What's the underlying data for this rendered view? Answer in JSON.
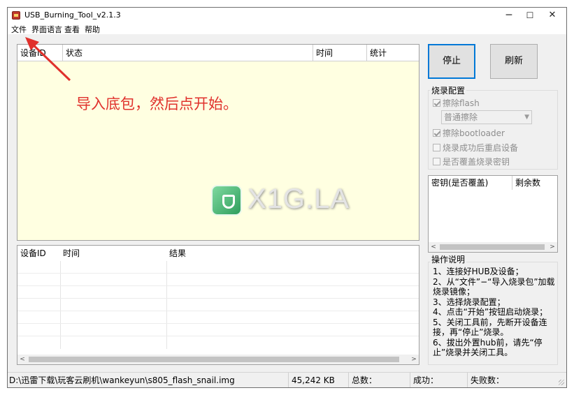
{
  "window": {
    "title": "USB_Burning_Tool_v2.1.3",
    "min": "─",
    "max": "☐",
    "close": "✕"
  },
  "menu": [
    "文件",
    "界面语言",
    "查看",
    "帮助"
  ],
  "device_table": {
    "columns": [
      "设备ID",
      "状态",
      "时间",
      "统计"
    ]
  },
  "hint": "导入底包，然后点开始。",
  "watermark": "X1G.LA",
  "result_table": {
    "columns": [
      "设备ID",
      "时间",
      "结果"
    ]
  },
  "buttons": {
    "stop": "停止",
    "refresh": "刷新"
  },
  "burn_config": {
    "title": "烧录配置",
    "erase_flash": "擦除flash",
    "erase_mode": "普通擦除",
    "erase_bootloader": "擦除bootloader",
    "reboot_after": "烧录成功后重启设备",
    "overwrite_key": "是否覆盖烧录密钥"
  },
  "key_table": {
    "columns": [
      "密钥(是否覆盖)",
      "剩余数"
    ]
  },
  "instructions": {
    "title": "操作说明",
    "text": "1、连接好HUB及设备；\n2、从“文件”−“导入烧录包”加载烧录镜像；\n3、选择烧录配置；\n4、点击“开始”按钮启动烧录；\n5、关闭工具前，先断开设备连接，再“停止”烧录。\n6、拔出外置hub前，请先“停止”烧录并关闭工具。"
  },
  "status": {
    "path": "D:\\迅雷下载\\玩客云刷机\\wankeyun\\s805_flash_snail.img",
    "size": "45,242 KB",
    "total": "总数：",
    "success": "成功：",
    "fail": "失败数："
  },
  "colors": {
    "hint": "#e0312c",
    "grid_bg": "#ffffe1",
    "focus": "#0078d7"
  }
}
